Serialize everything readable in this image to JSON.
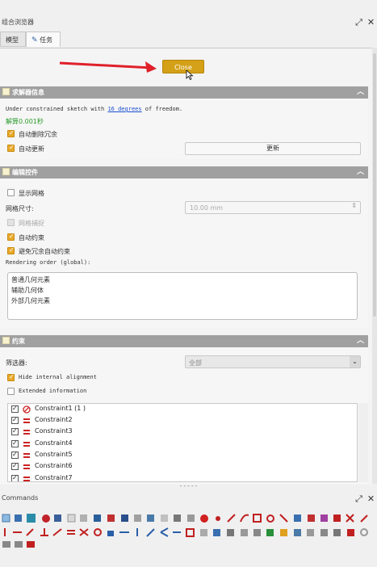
{
  "window": {
    "title": "组合浏览器"
  },
  "tabs": [
    {
      "label": "模型"
    },
    {
      "label": "任务"
    }
  ],
  "task": {
    "close_label": "Close"
  },
  "solver": {
    "header": "求解器信息",
    "message_prefix": "Under constrained sketch with ",
    "message_link": "16 degrees",
    "message_suffix": " of freedom.",
    "solve_time": "解算0.001秒",
    "auto_remove_redundant": "自动删除冗余",
    "auto_update": "自动更新",
    "update_button": "更新"
  },
  "edit_controls": {
    "header": "编辑控件",
    "show_grid": "显示网格",
    "grid_size_label": "网格尺寸:",
    "grid_size_value": "10.00 mm",
    "grid_snap": "网格捕捉",
    "auto_constraint": "自动约束",
    "avoid_redundant": "避免冗余自动约束",
    "render_order_label": "Rendering order (global):",
    "render_order": [
      "普通几何元素",
      "辅助几何体",
      "外部几何元素"
    ]
  },
  "constraints": {
    "header": "约束",
    "filter_label": "筛选器:",
    "filter_value": "全部",
    "hide_internal": "Hide internal alignment",
    "extended_info": "Extended information",
    "items": [
      {
        "label": "Constraint1 (1 )",
        "icon": "block-constraint-icon"
      },
      {
        "label": "Constraint2",
        "icon": "equal-constraint-icon"
      },
      {
        "label": "Constraint3",
        "icon": "equal-constraint-icon"
      },
      {
        "label": "Constraint4",
        "icon": "equal-constraint-icon"
      },
      {
        "label": "Constraint5",
        "icon": "equal-constraint-icon"
      },
      {
        "label": "Constraint6",
        "icon": "equal-constraint-icon"
      },
      {
        "label": "Constraint7",
        "icon": "equal-constraint-icon"
      }
    ]
  },
  "commands": {
    "title": "Commands"
  },
  "colors": {
    "accent": "#d4a017",
    "header": "#a0a0a0",
    "constraint_red": "#cc2222"
  }
}
